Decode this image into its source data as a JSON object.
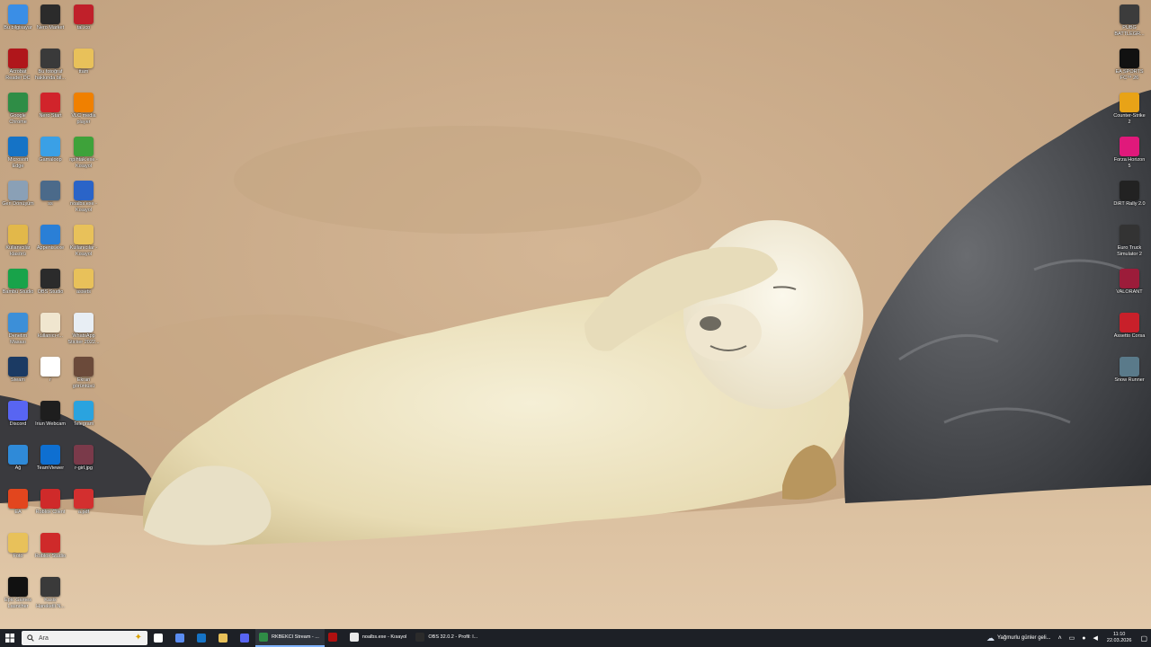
{
  "desktop": {
    "left_icons": [
      {
        "label": "Bu bilgisayar",
        "icon": "computer-icon",
        "color": "#3a8ee6"
      },
      {
        "label": "Nero Market",
        "icon": "nero-market-icon",
        "color": "#2b2b2b"
      },
      {
        "label": "tal.ico",
        "icon": "red-badge-icon",
        "color": "#c0202a"
      },
      {
        "label": "Acrobat Reader DC",
        "icon": "acrobat-icon",
        "color": "#b0161b"
      },
      {
        "label": "Bu fotoğraf hakkında bil...",
        "icon": "camera-icon",
        "color": "#3a3a3a"
      },
      {
        "label": "ttam",
        "icon": "folder-icon",
        "color": "#e8c15a"
      },
      {
        "label": "Google Chrome",
        "icon": "chrome-icon",
        "color": "#2f8d46"
      },
      {
        "label": "Nero Start",
        "icon": "nero-start-icon",
        "color": "#d1242b"
      },
      {
        "label": "VLC media player",
        "icon": "vlc-icon",
        "color": "#f08000"
      },
      {
        "label": "Microsoft Edge",
        "icon": "edge-icon",
        "color": "#1573c6"
      },
      {
        "label": "Gamaloop",
        "icon": "gameloop-icon",
        "color": "#3aa0e6"
      },
      {
        "label": "npihtak.exe - Kısayol",
        "icon": "green-app-icon",
        "color": "#3ea23a"
      },
      {
        "label": "Geri Dönüşüm",
        "icon": "recycle-bin-icon",
        "color": "#8aa0b6"
      },
      {
        "label": "ss",
        "icon": "screenshot-icon",
        "color": "#4b6a8a"
      },
      {
        "label": "noalbs.exe - Kısayol",
        "icon": "window-app-icon",
        "color": "#2a64c8"
      },
      {
        "label": "Kullanıcılar klasörü",
        "icon": "user-folder-icon",
        "color": "#e2b84a"
      },
      {
        "label": "Appenis.exe",
        "icon": "blue-tool-icon",
        "color": "#2a7fd6"
      },
      {
        "label": "Kullanıcılar - Kısayol",
        "icon": "folder-shortcut-icon",
        "color": "#e8c15a"
      },
      {
        "label": "Bambu Studio",
        "icon": "bambu-icon",
        "color": "#18a34a"
      },
      {
        "label": "OBS Studio",
        "icon": "obs-icon",
        "color": "#2b2b2b"
      },
      {
        "label": "assets",
        "icon": "folder-icon",
        "color": "#e8c15a"
      },
      {
        "label": "Denetim Masası",
        "icon": "control-panel-icon",
        "color": "#3c8fd8"
      },
      {
        "label": "kullanıcı-r...",
        "icon": "document-icon",
        "color": "#f0e6cf"
      },
      {
        "label": "WhatsApp Sticker 2022...",
        "icon": "image-file-icon",
        "color": "#e8eef4"
      },
      {
        "label": "Steam",
        "icon": "steam-icon",
        "color": "#1b3a63"
      },
      {
        "label": "r",
        "icon": "chrome-shortcut-icon",
        "color": "#ffffff"
      },
      {
        "label": "Ekran görüntüsü",
        "icon": "photo-icon",
        "color": "#6b4a3a"
      },
      {
        "label": "Discord",
        "icon": "discord-icon",
        "color": "#5865f2"
      },
      {
        "label": "Iriun Webcam",
        "icon": "webcam-icon",
        "color": "#1e1e1e"
      },
      {
        "label": "Telegram",
        "icon": "telegram-icon",
        "color": "#2aa3df"
      },
      {
        "label": "Ağ",
        "icon": "network-icon",
        "color": "#2f8ad8"
      },
      {
        "label": "TeamViewer",
        "icon": "teamviewer-icon",
        "color": "#0e6fd1"
      },
      {
        "label": "r-girl.jpg",
        "icon": "jpg-file-icon",
        "color": "#7a3a4a"
      },
      {
        "label": "EA",
        "icon": "ea-icon",
        "color": "#e2461e"
      },
      {
        "label": "Roblox Client",
        "icon": "roblox-client-icon",
        "color": "#cf2a2a"
      },
      {
        "label": "a.pdf",
        "icon": "pdf-icon",
        "color": "#d32f2f"
      },
      {
        "label": "Foto",
        "icon": "photo-folder-icon",
        "color": "#e8c15a"
      },
      {
        "label": "Roblox Studio",
        "icon": "roblox-studio-icon",
        "color": "#cf2a2a"
      },
      {
        "label": "",
        "icon": "blank-icon",
        "color": "#00000000"
      },
      {
        "label": "Epic Games Launcher",
        "icon": "epic-icon",
        "color": "#111111"
      },
      {
        "label": "Kasis Hareketli N...",
        "icon": "kasis-icon",
        "color": "#3a3a3a"
      }
    ],
    "right_icons": [
      {
        "label": "PUBG BATTLEGR...",
        "icon": "pubg-icon",
        "color": "#3c3c3c"
      },
      {
        "label": "EA SPORTS FC™ 26",
        "icon": "fc26-icon",
        "color": "#111111"
      },
      {
        "label": "Counter-Strike 2",
        "icon": "cs2-icon",
        "color": "#e8a317"
      },
      {
        "label": "Forza Horizon 5",
        "icon": "forza-icon",
        "color": "#e0197b"
      },
      {
        "label": "DiRT Rally 2.0",
        "icon": "dirt-icon",
        "color": "#222222"
      },
      {
        "label": "Euro Truck Simulator 2",
        "icon": "ets2-icon",
        "color": "#333333"
      },
      {
        "label": "VALORANT",
        "icon": "valorant-icon",
        "color": "#9c1c3a"
      },
      {
        "label": "Assetto Corsa",
        "icon": "assetto-icon",
        "color": "#c8202a"
      },
      {
        "label": "Snow Runner",
        "icon": "snowrunner-icon",
        "color": "#5a7a8a"
      }
    ]
  },
  "taskbar": {
    "start_icon": "windows-start-icon",
    "search_placeholder": "Ara",
    "pinned": [
      {
        "name": "task-view-icon",
        "color": "#ffffff"
      },
      {
        "name": "copilot-icon",
        "color": "#5a8cf0"
      },
      {
        "name": "edge-icon",
        "color": "#1573c6"
      },
      {
        "name": "file-explorer-icon",
        "color": "#e8c15a"
      },
      {
        "name": "discord-icon",
        "color": "#5865f2"
      }
    ],
    "apps": [
      {
        "label": "RKBEKCI Stream - ...",
        "icon": "chrome-icon",
        "color": "#2f8d46",
        "active": true
      },
      {
        "label": "",
        "icon": "red-app-icon",
        "color": "#b01010",
        "active": false
      },
      {
        "label": "noalbs.exe - Kısayol",
        "icon": "window-app-icon",
        "color": "#e8e8e8",
        "active": false
      },
      {
        "label": "OBS 32.0.2 - Profil: l...",
        "icon": "obs-icon",
        "color": "#2b2b2b",
        "active": false
      }
    ],
    "tray": {
      "weather_text": "Yağmurlu günler geli...",
      "time": "11:10",
      "date": "22.03.2026"
    }
  }
}
